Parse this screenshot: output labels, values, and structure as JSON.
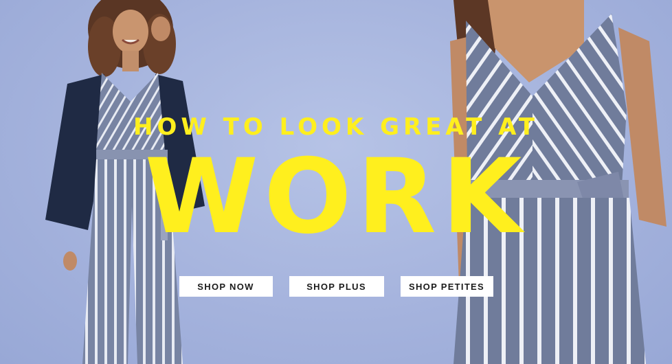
{
  "banner": {
    "headline": "HOW TO LOOK GREAT AT",
    "hero_word": "WORK",
    "colors": {
      "background": "#a9b7df",
      "headline": "#ffef1e",
      "button_bg": "#ffffff",
      "button_text": "#1b1b1b"
    },
    "buttons": [
      {
        "label": "SHOP NOW"
      },
      {
        "label": "SHOP PLUS"
      },
      {
        "label": "SHOP PETITES"
      }
    ]
  }
}
